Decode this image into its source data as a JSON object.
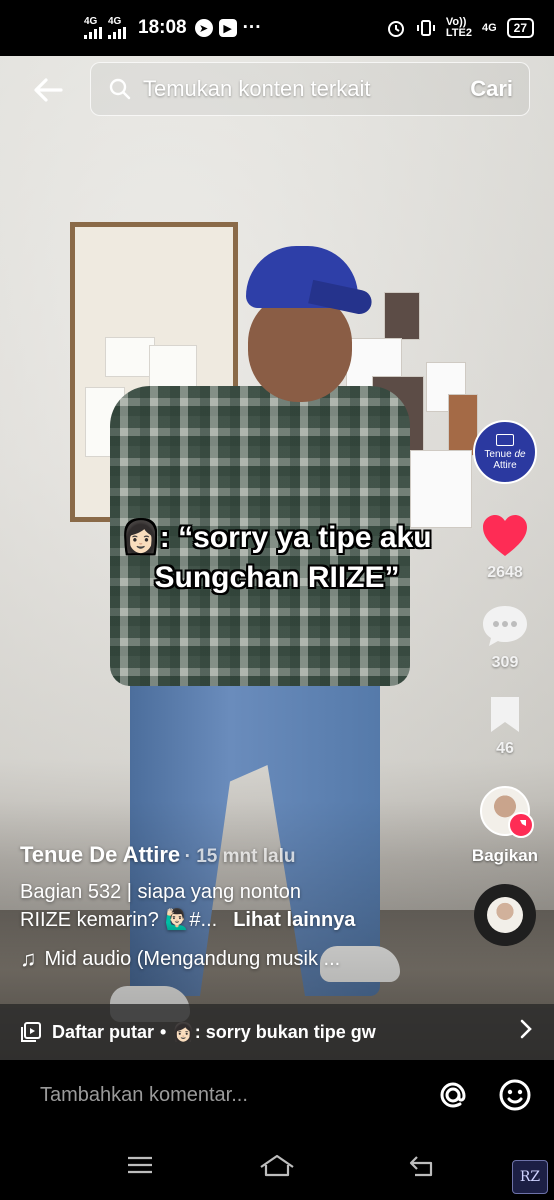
{
  "status_bar": {
    "network_1": "4G",
    "network_2": "4G",
    "time": "18:08",
    "more": "···",
    "volte_line1": "Vo))",
    "volte_line2": "LTE2",
    "network_3": "4G",
    "battery": "27"
  },
  "search": {
    "placeholder": "Temukan konten terkait",
    "button": "Cari"
  },
  "video": {
    "caption_line1": "👩🏻: “sorry ya tipe aku",
    "caption_line2": "Sungchan RIIZE”"
  },
  "actions": {
    "creator_avatar_text_1": "Tenue",
    "creator_avatar_text_2": "de",
    "creator_avatar_text_3": "Attire",
    "likes": "2648",
    "comments": "309",
    "saves": "46",
    "share_label": "Bagikan"
  },
  "info": {
    "author": "Tenue De Attire",
    "time_ago": "· 15 mnt lalu",
    "description_line1": "Bagian 532 | siapa yang nonton",
    "description_line2": "RIIZE kemarin? 🙋🏻‍♂️#...",
    "see_more": "Lihat lainnya",
    "music": "Mid audio (Mengandung musik ..."
  },
  "playlist": {
    "label": "Daftar putar",
    "separator": "•",
    "title": "👩🏻: sorry bukan tipe gw"
  },
  "comment_bar": {
    "placeholder": "Tambahkan komentar..."
  },
  "watermark": "RZ",
  "colors": {
    "like_red": "#fe2c55",
    "avatar_blue": "#2b39a0"
  }
}
